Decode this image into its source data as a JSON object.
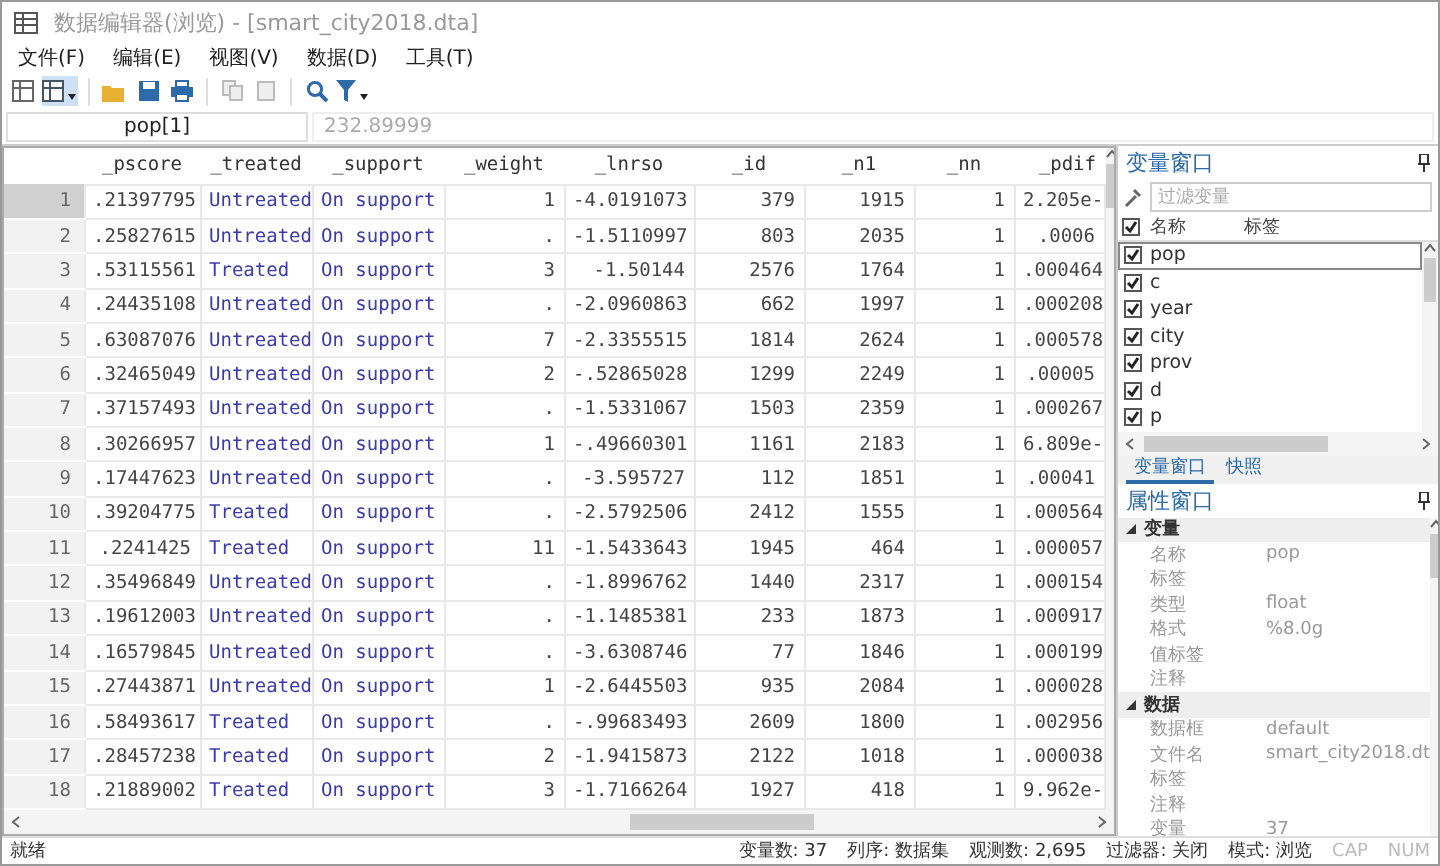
{
  "window": {
    "title": "数据编辑器(浏览) - [smart_city2018.dta]"
  },
  "menu": [
    "文件(F)",
    "编辑(E)",
    "视图(V)",
    "数据(D)",
    "工具(T)"
  ],
  "cell_bar": {
    "name": "pop[1]",
    "value": "232.89999"
  },
  "table": {
    "columns": [
      "_pscore",
      "_treated",
      "_support",
      "_weight",
      "_lnrso",
      "_id",
      "_n1",
      "_nn",
      "_pdif"
    ],
    "rows": [
      {
        "number": "1",
        "selected": true,
        "cells": [
          ".21397795",
          "Untreated",
          "On support",
          "1",
          "-4.0191073",
          "379",
          "1915",
          "1",
          "2.205e-"
        ]
      },
      {
        "number": "2",
        "selected": false,
        "cells": [
          ".25827615",
          "Untreated",
          "On support",
          ".",
          "-1.5110997",
          "803",
          "2035",
          "1",
          ".0006"
        ]
      },
      {
        "number": "3",
        "selected": false,
        "cells": [
          ".53115561",
          "Treated",
          "On support",
          "3",
          "-1.50144",
          "2576",
          "1764",
          "1",
          ".000464"
        ]
      },
      {
        "number": "4",
        "selected": false,
        "cells": [
          ".24435108",
          "Untreated",
          "On support",
          ".",
          "-2.0960863",
          "662",
          "1997",
          "1",
          ".000208"
        ]
      },
      {
        "number": "5",
        "selected": false,
        "cells": [
          ".63087076",
          "Untreated",
          "On support",
          "7",
          "-2.3355515",
          "1814",
          "2624",
          "1",
          ".000578"
        ]
      },
      {
        "number": "6",
        "selected": false,
        "cells": [
          ".32465049",
          "Untreated",
          "On support",
          "2",
          "-.52865028",
          "1299",
          "2249",
          "1",
          ".00005"
        ]
      },
      {
        "number": "7",
        "selected": false,
        "cells": [
          ".37157493",
          "Untreated",
          "On support",
          ".",
          "-1.5331067",
          "1503",
          "2359",
          "1",
          ".000267"
        ]
      },
      {
        "number": "8",
        "selected": false,
        "cells": [
          ".30266957",
          "Untreated",
          "On support",
          "1",
          "-.49660301",
          "1161",
          "2183",
          "1",
          "6.809e-"
        ]
      },
      {
        "number": "9",
        "selected": false,
        "cells": [
          ".17447623",
          "Untreated",
          "On support",
          ".",
          "-3.595727",
          "112",
          "1851",
          "1",
          ".00041"
        ]
      },
      {
        "number": "10",
        "selected": false,
        "cells": [
          ".39204775",
          "Treated",
          "On support",
          ".",
          "-2.5792506",
          "2412",
          "1555",
          "1",
          ".000564"
        ]
      },
      {
        "number": "11",
        "selected": false,
        "cells": [
          ".2241425",
          "Treated",
          "On support",
          "11",
          "-1.5433643",
          "1945",
          "464",
          "1",
          ".000057"
        ]
      },
      {
        "number": "12",
        "selected": false,
        "cells": [
          ".35496849",
          "Untreated",
          "On support",
          ".",
          "-1.8996762",
          "1440",
          "2317",
          "1",
          ".000154"
        ]
      },
      {
        "number": "13",
        "selected": false,
        "cells": [
          ".19612003",
          "Untreated",
          "On support",
          ".",
          "-1.1485381",
          "233",
          "1873",
          "1",
          ".000917"
        ]
      },
      {
        "number": "14",
        "selected": false,
        "cells": [
          ".16579845",
          "Untreated",
          "On support",
          ".",
          "-3.6308746",
          "77",
          "1846",
          "1",
          ".000199"
        ]
      },
      {
        "number": "15",
        "selected": false,
        "cells": [
          ".27443871",
          "Untreated",
          "On support",
          "1",
          "-2.6445503",
          "935",
          "2084",
          "1",
          ".000028"
        ]
      },
      {
        "number": "16",
        "selected": false,
        "cells": [
          ".58493617",
          "Treated",
          "On support",
          ".",
          "-.99683493",
          "2609",
          "1800",
          "1",
          ".002956"
        ]
      },
      {
        "number": "17",
        "selected": false,
        "cells": [
          ".28457238",
          "Treated",
          "On support",
          "2",
          "-1.9415873",
          "2122",
          "1018",
          "1",
          ".000038"
        ]
      },
      {
        "number": "18",
        "selected": false,
        "cells": [
          ".21889002",
          "Treated",
          "On support",
          "3",
          "-1.7166264",
          "1927",
          "418",
          "1",
          "9.962e-"
        ]
      }
    ]
  },
  "variables_panel": {
    "title": "变量窗口",
    "filter_placeholder": "过滤变量",
    "columns": [
      "名称",
      "标签"
    ],
    "all_checked": true,
    "items": [
      {
        "name": "pop",
        "checked": true,
        "selected": true
      },
      {
        "name": "c",
        "checked": true,
        "selected": false
      },
      {
        "name": "year",
        "checked": true,
        "selected": false
      },
      {
        "name": "city",
        "checked": true,
        "selected": false
      },
      {
        "name": "prov",
        "checked": true,
        "selected": false
      },
      {
        "name": "d",
        "checked": true,
        "selected": false
      },
      {
        "name": "p",
        "checked": true,
        "selected": false
      }
    ],
    "tabs": [
      {
        "label": "变量窗口",
        "selected": true
      },
      {
        "label": "快照",
        "selected": false
      }
    ]
  },
  "properties_panel": {
    "title": "属性窗口",
    "groups": [
      {
        "name": "变量",
        "rows": [
          {
            "key": "名称",
            "value": "pop"
          },
          {
            "key": "标签"
          },
          {
            "key": "类型",
            "value": "float"
          },
          {
            "key": "格式",
            "value": "%8.0g"
          },
          {
            "key": "值标签"
          },
          {
            "key": "注释"
          }
        ]
      },
      {
        "name": "数据",
        "rows": [
          {
            "key": "数据框",
            "value": "default"
          },
          {
            "key": "文件名",
            "value": "smart_city2018.dt"
          },
          {
            "key": "标签"
          },
          {
            "key": "注释"
          },
          {
            "key": "变量",
            "value": "37"
          }
        ]
      }
    ]
  },
  "status_bar": {
    "state": "就绪",
    "items": [
      "变量数: 37",
      "列序: 数据集",
      "观测数: 2,695",
      "过滤器: 关闭",
      "模式: 浏览"
    ],
    "indicators": [
      {
        "label": "CAP",
        "on": false
      },
      {
        "label": "NUM",
        "on": false
      }
    ]
  }
}
